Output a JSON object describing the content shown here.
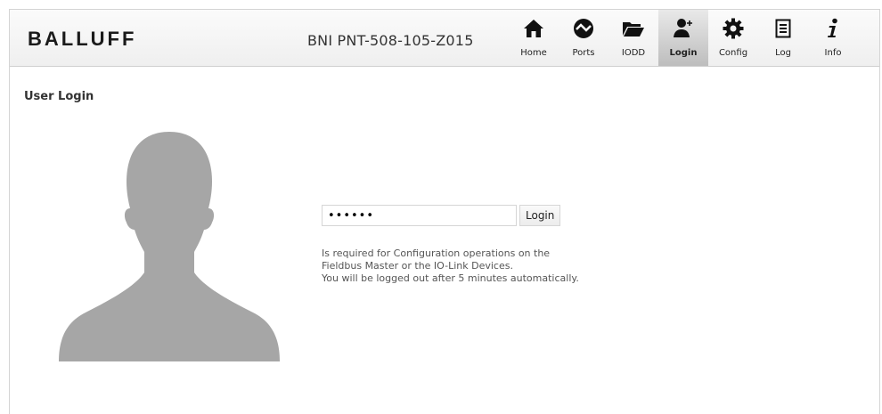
{
  "header": {
    "logo_text": "BALLUFF",
    "device_name": "BNI PNT-508-105-Z015"
  },
  "nav": {
    "items": [
      {
        "label": "Home",
        "icon": "home-icon"
      },
      {
        "label": "Ports",
        "icon": "ports-icon"
      },
      {
        "label": "IODD",
        "icon": "folder-icon"
      },
      {
        "label": "Login",
        "icon": "user-login-icon",
        "active": true
      },
      {
        "label": "Config",
        "icon": "gear-icon"
      },
      {
        "label": "Log",
        "icon": "log-icon"
      },
      {
        "label": "Info",
        "icon": "info-icon"
      }
    ]
  },
  "page": {
    "title": "User Login"
  },
  "login": {
    "password_value": "••••••",
    "button_label": "Login",
    "info_lines": [
      "Is required for Configuration operations on the",
      "Fieldbus Master or the IO-Link Devices.",
      "You will be logged out after 5 minutes automatically."
    ]
  },
  "colors": {
    "silhouette": "#a6a6a6",
    "active_tab": "#bdbdbd",
    "header_bg": "#f3f3f3"
  }
}
